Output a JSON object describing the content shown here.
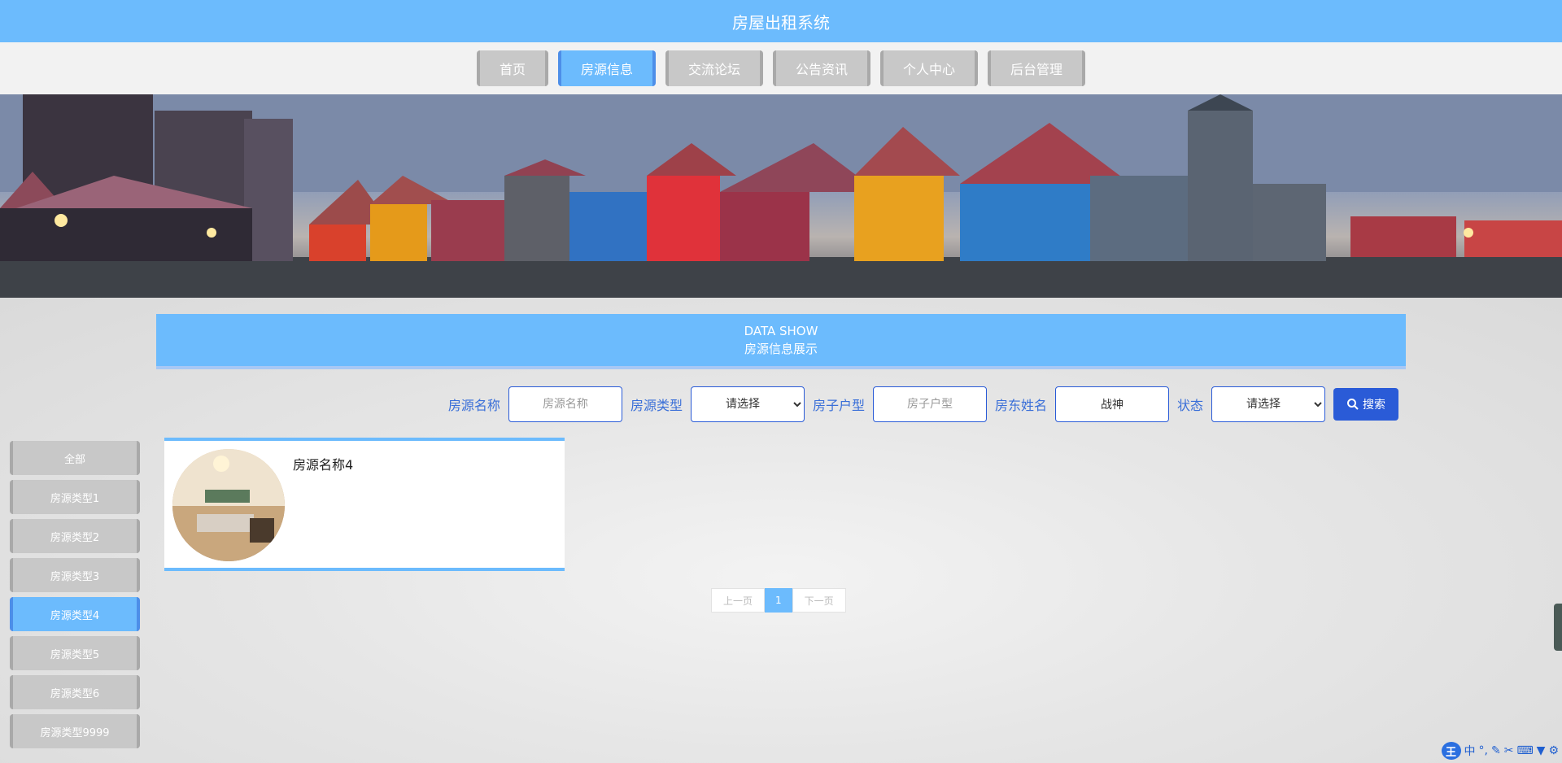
{
  "header": {
    "title": "房屋出租系统"
  },
  "nav": {
    "items": [
      {
        "label": "首页",
        "active": false
      },
      {
        "label": "房源信息",
        "active": true
      },
      {
        "label": "交流论坛",
        "active": false
      },
      {
        "label": "公告资讯",
        "active": false
      },
      {
        "label": "个人中心",
        "active": false
      },
      {
        "label": "后台管理",
        "active": false
      }
    ]
  },
  "section": {
    "title_en": "DATA SHOW",
    "title_cn": "房源信息展示"
  },
  "search": {
    "name_label": "房源名称",
    "name_placeholder": "房源名称",
    "name_value": "",
    "type_label": "房源类型",
    "type_selected": "请选择",
    "layout_label": "房子户型",
    "layout_placeholder": "房子户型",
    "layout_value": "",
    "owner_label": "房东姓名",
    "owner_value": "战神",
    "status_label": "状态",
    "status_selected": "请选择",
    "button_label": "搜索"
  },
  "sidebar": {
    "items": [
      {
        "label": "全部",
        "active": false
      },
      {
        "label": "房源类型1",
        "active": false
      },
      {
        "label": "房源类型2",
        "active": false
      },
      {
        "label": "房源类型3",
        "active": false
      },
      {
        "label": "房源类型4",
        "active": true
      },
      {
        "label": "房源类型5",
        "active": false
      },
      {
        "label": "房源类型6",
        "active": false
      },
      {
        "label": "房源类型9999",
        "active": false
      }
    ]
  },
  "cards": [
    {
      "title": "房源名称4"
    }
  ],
  "pagination": {
    "prev": "上一页",
    "current": "1",
    "next": "下一页"
  },
  "ime": {
    "logo": "王",
    "lang": "中",
    "punct": "°,"
  },
  "colors": {
    "primary": "#6cbbfd",
    "accent": "#2a5bd7",
    "inactive": "#c8c8c8"
  }
}
